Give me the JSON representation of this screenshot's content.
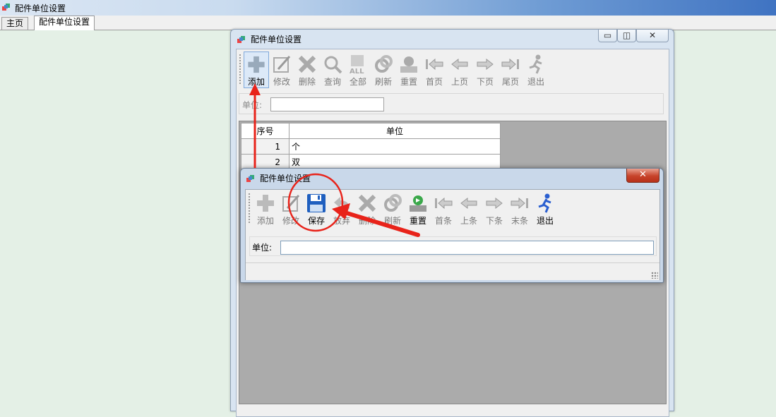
{
  "app": {
    "title": "配件单位设置",
    "tabs": [
      {
        "label": "主页",
        "active": false
      },
      {
        "label": "配件单位设置",
        "active": true
      }
    ]
  },
  "mdi_window": {
    "title": "配件单位设置",
    "control_icons": {
      "minimize": "minimize-icon",
      "restore": "restore-icon",
      "close": "close-icon"
    },
    "toolbar": [
      {
        "label": "添加",
        "icon": "add-icon",
        "enabled": true,
        "highlighted": true
      },
      {
        "label": "修改",
        "icon": "edit-icon",
        "enabled": false
      },
      {
        "label": "删除",
        "icon": "delete-icon",
        "enabled": false
      },
      {
        "label": "查询",
        "icon": "search-icon",
        "enabled": false
      },
      {
        "label": "全部",
        "icon": "all-icon",
        "enabled": false
      },
      {
        "label": "刷新",
        "icon": "refresh-icon",
        "enabled": false
      },
      {
        "label": "重置",
        "icon": "reset-icon",
        "enabled": false
      },
      {
        "label": "首页",
        "icon": "first-page-icon",
        "enabled": false
      },
      {
        "label": "上页",
        "icon": "prev-page-icon",
        "enabled": false
      },
      {
        "label": "下页",
        "icon": "next-page-icon",
        "enabled": false
      },
      {
        "label": "尾页",
        "icon": "last-page-icon",
        "enabled": false
      },
      {
        "label": "退出",
        "icon": "exit-icon",
        "enabled": false
      }
    ],
    "filter_label": "单位:",
    "filter_value": "",
    "grid": {
      "columns": [
        "序号",
        "单位"
      ],
      "rows": [
        {
          "index": "1",
          "unit": "个"
        },
        {
          "index": "2",
          "unit": "双"
        }
      ]
    }
  },
  "dialog": {
    "title": "配件单位设置",
    "close_icon": "close-icon",
    "toolbar": [
      {
        "label": "添加",
        "icon": "add-icon",
        "enabled": false
      },
      {
        "label": "修改",
        "icon": "edit-icon",
        "enabled": false
      },
      {
        "label": "保存",
        "icon": "save-icon",
        "enabled": true
      },
      {
        "label": "放弃",
        "icon": "undo-icon",
        "enabled": false
      },
      {
        "label": "删除",
        "icon": "delete-icon",
        "enabled": false
      },
      {
        "label": "刷新",
        "icon": "refresh-icon",
        "enabled": false
      },
      {
        "label": "重置",
        "icon": "reset-icon",
        "enabled": true
      },
      {
        "label": "首条",
        "icon": "first-record-icon",
        "enabled": false
      },
      {
        "label": "上条",
        "icon": "prev-record-icon",
        "enabled": false
      },
      {
        "label": "下条",
        "icon": "next-record-icon",
        "enabled": false
      },
      {
        "label": "末条",
        "icon": "last-record-icon",
        "enabled": false
      },
      {
        "label": "退出",
        "icon": "exit-icon",
        "enabled": true
      }
    ],
    "field_label": "单位:",
    "field_value": ""
  },
  "colors": {
    "annotation_red": "#e8231a",
    "workspace_bg": "#e4f0e6",
    "grid_empty_bg": "#ababab",
    "save_blue": "#1f5fbf"
  }
}
